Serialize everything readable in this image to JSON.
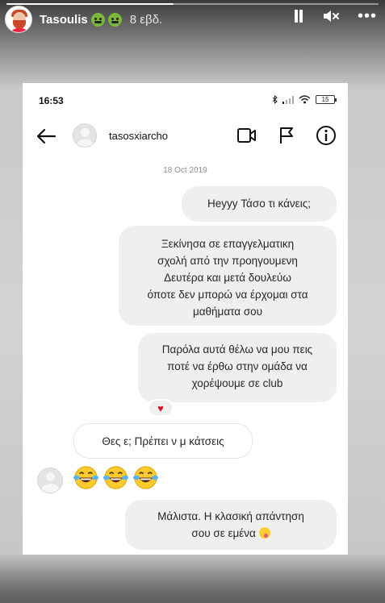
{
  "story": {
    "username": "Tasoulis",
    "time_ago": "8 εβδ.",
    "progress": 0.45,
    "icons": [
      "pause-icon",
      "mute-icon",
      "more-options-icon"
    ]
  },
  "phone_status": {
    "time": "16:53",
    "battery": "15"
  },
  "dm": {
    "username": "tasosxiarcho",
    "header_icons": [
      "back-arrow-icon",
      "video-call-icon",
      "flag-icon",
      "info-icon"
    ]
  },
  "conversation": {
    "date": "18 Oct 2019",
    "messages": [
      {
        "from": "me",
        "text": "Ηeyyy Τάσο τι κάνεις;"
      },
      {
        "from": "me",
        "lines": [
          "Ξεκίνησα σε επαγγελματικη",
          "σχολή από την προηγουμενη",
          "Δευτέρα και μετά δουλεύω",
          "όποτε δεν μπορώ να έρχομαι στα",
          "μαθήματα σου"
        ]
      },
      {
        "from": "me",
        "lines": [
          "Παρόλα αυτά θέλω να μου πεις",
          "ποτέ να έρθω στην ομάδα να",
          "χορέψουμε σε club"
        ],
        "reaction": "♥"
      },
      {
        "from": "them",
        "text": "Θες ε; Πρέπει ν μ κάτσεις"
      },
      {
        "from": "them",
        "emoji": "face-with-tears-of-joy x3"
      },
      {
        "from": "me",
        "lines": [
          "Μάλιστα. Η κλασική απάντηση",
          "σου σε εμένα"
        ],
        "emoji": "face-savoring-food"
      }
    ]
  },
  "colors": {
    "bubble": "#efefef",
    "heart": "#d1152b",
    "text": "#262626"
  }
}
